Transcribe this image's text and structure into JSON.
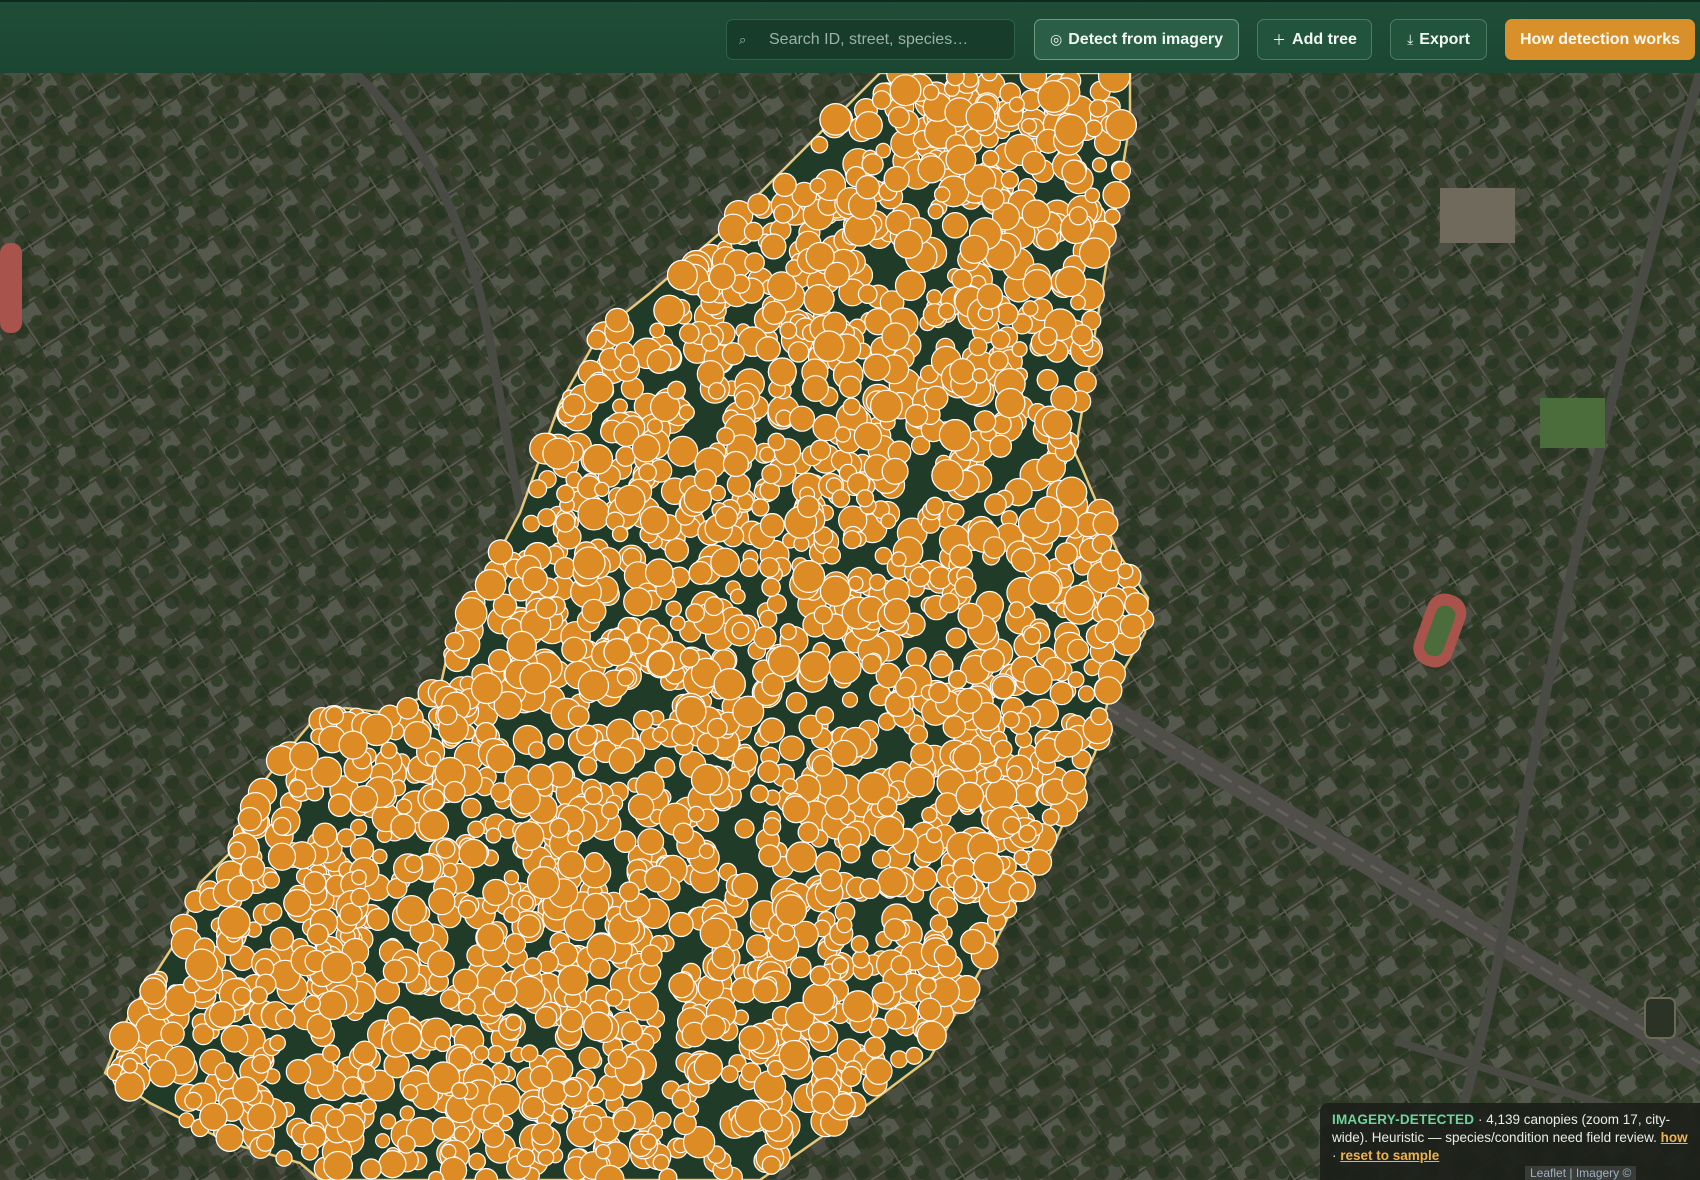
{
  "toolbar": {
    "search_placeholder": "Search ID, street, species…",
    "search_icon": "search-icon",
    "detect_label": "Detect from imagery",
    "detect_icon": "target-icon",
    "add_label": "Add tree",
    "add_icon": "plus-icon",
    "export_label": "Export",
    "export_icon": "download-icon",
    "how_label": "How detection works"
  },
  "status": {
    "tag": "IMAGERY-DETECTED",
    "text": " · 4,139 canopies (zoom 17, city-wide). Heuristic — species/condition need field review. ",
    "how_link": "how",
    "separator": " · ",
    "reset_link": "reset to sample"
  },
  "attribution": {
    "text": "Leaflet | Imagery ©"
  },
  "colors": {
    "header": "#1f4d38",
    "accent": "#d9902a",
    "marker_fill": "#dc8b25",
    "marker_stroke": "#ffffff",
    "boundary": "#e8c77a",
    "status_tag": "#6fd39a"
  }
}
